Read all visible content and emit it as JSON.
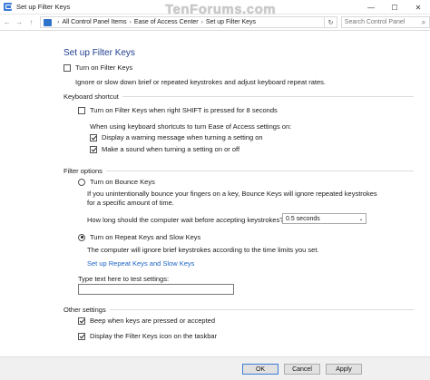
{
  "window": {
    "title": "Set up Filter Keys",
    "controls": {
      "minimize": "—",
      "maximize": "☐",
      "close": "✕"
    }
  },
  "address": {
    "back": "←",
    "forward": "→",
    "up": "↑",
    "crumbs": [
      "All Control Panel Items",
      "Ease of Access Center",
      "Set up Filter Keys"
    ],
    "separator": "›",
    "dropdown": "⌄",
    "refresh": "↻",
    "search_placeholder": "Search Control Panel",
    "search_icon_glyph": "⌕"
  },
  "watermark": "TenForums.com",
  "page": {
    "heading": "Set up Filter Keys",
    "turn_on_filter_keys": {
      "label": "Turn on Filter Keys",
      "checked": false
    },
    "filter_keys_desc": "Ignore or slow down brief or repeated keystrokes and adjust keyboard repeat rates.",
    "keyboard_shortcut": {
      "group_label": "Keyboard shortcut",
      "shift_shortcut": {
        "label": "Turn on Filter Keys when right SHIFT is pressed for 8 seconds",
        "checked": false
      },
      "when_using_text": "When using keyboard shortcuts to turn Ease of Access settings on:",
      "warning_message": {
        "label": "Display a warning message when turning a setting on",
        "checked": true
      },
      "make_sound": {
        "label": "Make a sound when turning a setting on or off",
        "checked": true
      }
    },
    "filter_options": {
      "group_label": "Filter options",
      "bounce_keys": {
        "label": "Turn on Bounce Keys",
        "checked": false
      },
      "bounce_desc": "If you unintentionally bounce your fingers on a key, Bounce Keys will ignore repeated keystrokes for a specific amount of time.",
      "wait_question": "How long should the computer wait before accepting keystrokes?",
      "wait_value": "0.5 seconds",
      "repeat_slow_keys": {
        "label": "Turn on Repeat Keys and Slow Keys",
        "checked": true
      },
      "repeat_desc": "The computer will ignore brief keystrokes according to the time limits you set.",
      "setup_link": "Set up Repeat Keys and Slow Keys",
      "test_label": "Type text here to test settings:",
      "test_value": ""
    },
    "other_settings": {
      "group_label": "Other settings",
      "beep": {
        "label": "Beep when keys are pressed or accepted",
        "checked": true
      },
      "taskbar_icon": {
        "label": "Display the Filter Keys icon on the taskbar",
        "checked": true
      }
    }
  },
  "footer": {
    "ok": "OK",
    "cancel": "Cancel",
    "apply": "Apply"
  },
  "colors": {
    "heading": "#1e3d8f",
    "link": "#1c64c4",
    "accent": "#3b7dd8"
  }
}
